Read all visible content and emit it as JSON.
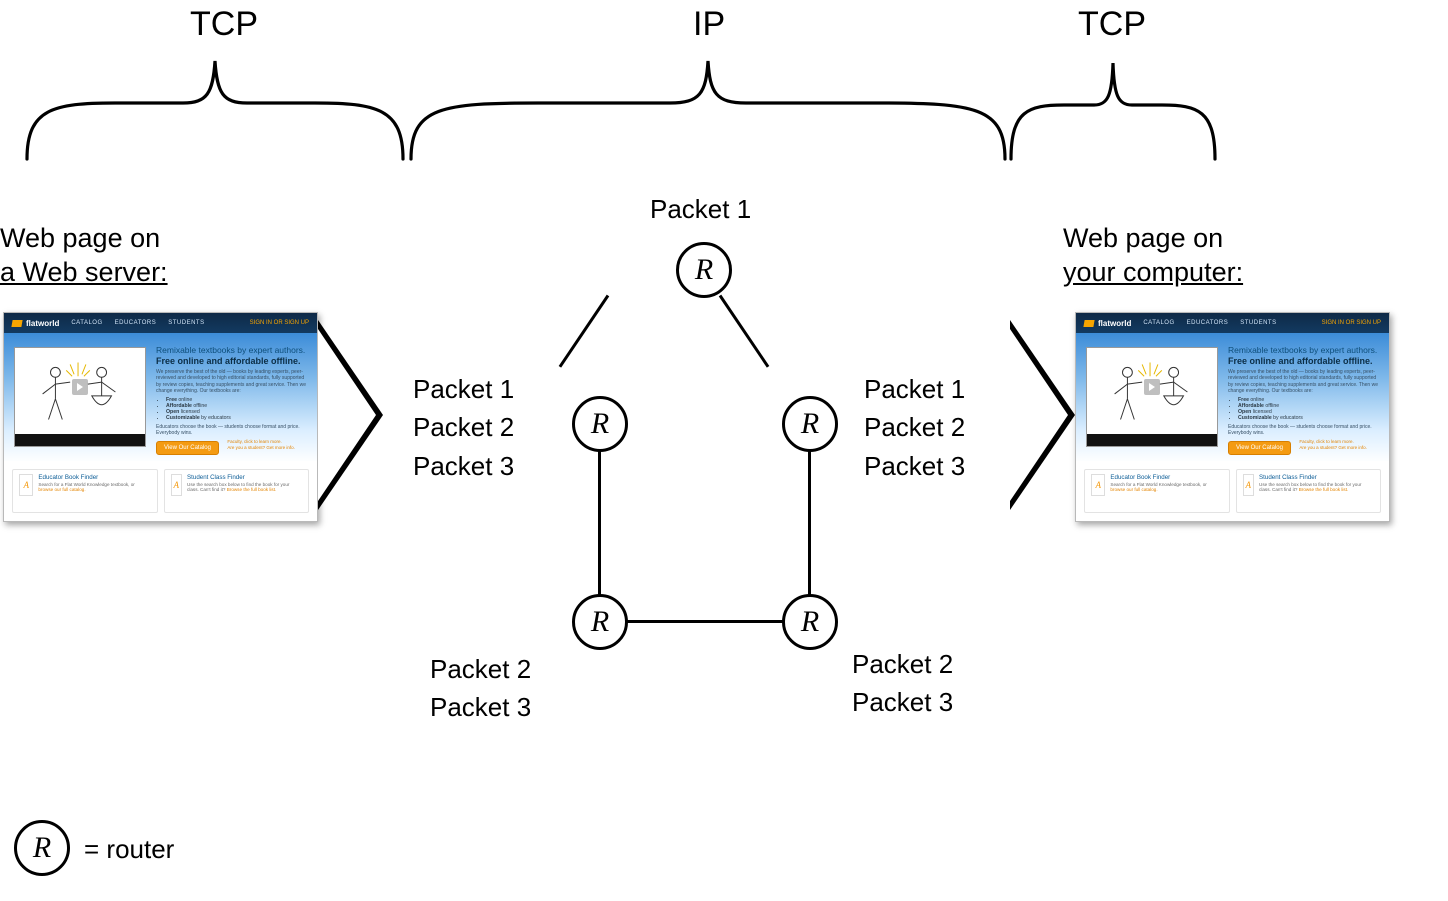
{
  "headings": {
    "tcp_left": "TCP",
    "ip": "IP",
    "tcp_right": "TCP"
  },
  "subheadings": {
    "left_line1": "Web page on",
    "left_line2": "a Web server:",
    "right_line1": "Web page on",
    "right_line2": "your computer:"
  },
  "entry_packets": {
    "p1": "Packet 1",
    "p2": "Packet 2",
    "p3": "Packet 3"
  },
  "exit_packets": {
    "p1": "Packet 1",
    "p2": "Packet 2",
    "p3": "Packet 3"
  },
  "top_packet_label": "Packet 1",
  "bottom_left_packets": {
    "p2": "Packet 2",
    "p3": "Packet 3"
  },
  "bottom_right_packets": {
    "p2": "Packet 2",
    "p3": "Packet 3"
  },
  "legend": {
    "router_eq": "= router"
  },
  "router_letter": "R",
  "webcard": {
    "brand": "flatworld",
    "nav": {
      "a": "CATALOG",
      "b": "EDUCATORS",
      "c": "STUDENTS"
    },
    "signin": "SIGN IN OR SIGN UP",
    "hero": {
      "h1": "Remixable textbooks by expert authors.",
      "h2": "Free online and affordable offline.",
      "p": "We preserve the best of the old — books by leading experts, peer-reviewed and developed to high editorial standards, fully supported by review copies, teaching supplements and great service. Then we change everything. Our textbooks are:",
      "b1a": "Free",
      "b1b": " online",
      "b2a": "Affordable",
      "b2b": " offline",
      "b3a": "Open",
      "b3b": " licensed",
      "b4a": "Customizable",
      "b4b": " by educators",
      "p2": "Educators choose the book — students choose format and price. Everybody wins.",
      "cta": "View Our Catalog",
      "ctal1": "Faculty, click to learn more.",
      "ctal2": "Are you a student? Get more info."
    },
    "finders": {
      "left": {
        "title": "Educator Book Finder",
        "sub": "Search for a Flat World Knowledge textbook, or ",
        "link": "browse our full catalog."
      },
      "right": {
        "title": "Student Class Finder",
        "sub": "Use the search box below to find the book for your class. Can't find it? ",
        "link": "Browse the full book list."
      }
    }
  }
}
